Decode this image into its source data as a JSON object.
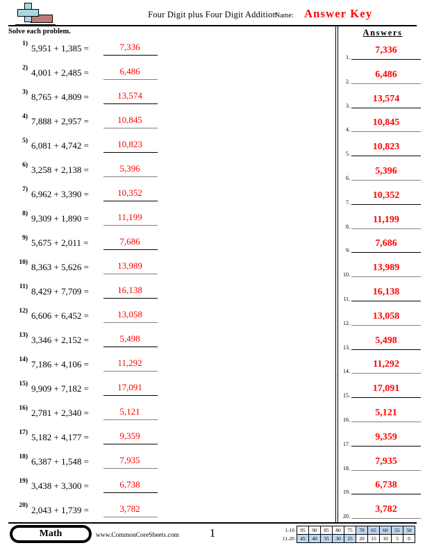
{
  "header": {
    "title": "Four Digit plus Four Digit Addition",
    "name_label": "Name:",
    "answer_key": "Answer Key",
    "logo_icon": "plus-block-logo"
  },
  "instructions": "Solve each problem.",
  "answers_heading": "Answers",
  "problems": [
    {
      "num": "1)",
      "text": "5,951 + 1,385 =",
      "answer": "7,336"
    },
    {
      "num": "2)",
      "text": "4,001 + 2,485 =",
      "answer": "6,486"
    },
    {
      "num": "3)",
      "text": "8,765 + 4,809 =",
      "answer": "13,574"
    },
    {
      "num": "4)",
      "text": "7,888 + 2,957 =",
      "answer": "10,845"
    },
    {
      "num": "5)",
      "text": "6,081 + 4,742 =",
      "answer": "10,823"
    },
    {
      "num": "6)",
      "text": "3,258 + 2,138 =",
      "answer": "5,396"
    },
    {
      "num": "7)",
      "text": "6,962 + 3,390 =",
      "answer": "10,352"
    },
    {
      "num": "8)",
      "text": "9,309 + 1,890 =",
      "answer": "11,199"
    },
    {
      "num": "9)",
      "text": "5,675 + 2,011 =",
      "answer": "7,686"
    },
    {
      "num": "10)",
      "text": "8,363 + 5,626 =",
      "answer": "13,989"
    },
    {
      "num": "11)",
      "text": "8,429 + 7,709 =",
      "answer": "16,138"
    },
    {
      "num": "12)",
      "text": "6,606 + 6,452 =",
      "answer": "13,058"
    },
    {
      "num": "13)",
      "text": "3,346 + 2,152 =",
      "answer": "5,498"
    },
    {
      "num": "14)",
      "text": "7,186 + 4,106 =",
      "answer": "11,292"
    },
    {
      "num": "15)",
      "text": "9,909 + 7,182 =",
      "answer": "17,091"
    },
    {
      "num": "16)",
      "text": "2,781 + 2,340 =",
      "answer": "5,121"
    },
    {
      "num": "17)",
      "text": "5,182 + 4,177 =",
      "answer": "9,359"
    },
    {
      "num": "18)",
      "text": "6,387 + 1,548 =",
      "answer": "7,935"
    },
    {
      "num": "19)",
      "text": "3,438 + 3,300 =",
      "answer": "6,738"
    },
    {
      "num": "20)",
      "text": "2,043 + 1,739 =",
      "answer": "3,782"
    }
  ],
  "answers": [
    {
      "num": "1.",
      "value": "7,336"
    },
    {
      "num": "2.",
      "value": "6,486"
    },
    {
      "num": "3.",
      "value": "13,574"
    },
    {
      "num": "4.",
      "value": "10,845"
    },
    {
      "num": "5.",
      "value": "10,823"
    },
    {
      "num": "6.",
      "value": "5,396"
    },
    {
      "num": "7.",
      "value": "10,352"
    },
    {
      "num": "8.",
      "value": "11,199"
    },
    {
      "num": "9.",
      "value": "7,686"
    },
    {
      "num": "10.",
      "value": "13,989"
    },
    {
      "num": "11.",
      "value": "16,138"
    },
    {
      "num": "12.",
      "value": "13,058"
    },
    {
      "num": "13.",
      "value": "5,498"
    },
    {
      "num": "14.",
      "value": "11,292"
    },
    {
      "num": "15.",
      "value": "17,091"
    },
    {
      "num": "16.",
      "value": "5,121"
    },
    {
      "num": "17.",
      "value": "9,359"
    },
    {
      "num": "18.",
      "value": "7,935"
    },
    {
      "num": "19.",
      "value": "6,738"
    },
    {
      "num": "20.",
      "value": "3,782"
    }
  ],
  "footer": {
    "subject_badge": "Math",
    "site_url": "www.CommonCoreSheets.com",
    "page_number": "1"
  },
  "grading_scale": {
    "rows": [
      {
        "label": "1-10",
        "cells": [
          {
            "value": "95",
            "highlighted": false
          },
          {
            "value": "90",
            "highlighted": false
          },
          {
            "value": "85",
            "highlighted": false
          },
          {
            "value": "80",
            "highlighted": false
          },
          {
            "value": "75",
            "highlighted": false
          },
          {
            "value": "70",
            "highlighted": true
          },
          {
            "value": "65",
            "highlighted": true
          },
          {
            "value": "60",
            "highlighted": true
          },
          {
            "value": "55",
            "highlighted": true
          },
          {
            "value": "50",
            "highlighted": true
          }
        ]
      },
      {
        "label": "11-20",
        "cells": [
          {
            "value": "45",
            "highlighted": true
          },
          {
            "value": "40",
            "highlighted": true
          },
          {
            "value": "35",
            "highlighted": true
          },
          {
            "value": "30",
            "highlighted": true
          },
          {
            "value": "25",
            "highlighted": true
          },
          {
            "value": "20",
            "highlighted": false
          },
          {
            "value": "15",
            "highlighted": false
          },
          {
            "value": "10",
            "highlighted": false
          },
          {
            "value": "5",
            "highlighted": false
          },
          {
            "value": "0",
            "highlighted": false
          }
        ]
      }
    ]
  },
  "colors": {
    "answer_red": "#ff0000",
    "highlight_blue": "#bdd7ee",
    "logo_blue": "#a8d8dd",
    "logo_red": "#bd7b7b",
    "gray_rule": "#808080"
  }
}
